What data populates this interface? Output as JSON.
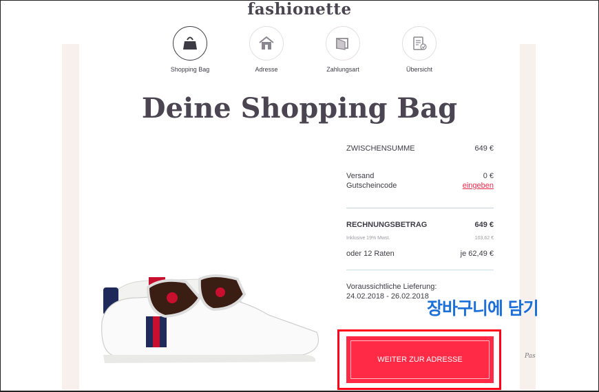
{
  "brand": {
    "logo": "fashionette"
  },
  "steps": [
    {
      "label": "Shopping Bag",
      "icon": "bag-icon",
      "active": true
    },
    {
      "label": "Adresse",
      "icon": "house-icon",
      "active": false
    },
    {
      "label": "Zahlungsart",
      "icon": "wallet-icon",
      "active": false
    },
    {
      "label": "Übersicht",
      "icon": "checklist-icon",
      "active": false
    }
  ],
  "page_title": "Deine Shopping Bag",
  "summary": {
    "subtotal_label": "ZWISCHENSUMME",
    "subtotal_value": "649 €",
    "shipping_label": "Versand",
    "shipping_value": "0 €",
    "voucher_label": "Gutscheincode",
    "voucher_link": "eingeben",
    "total_label": "RECHNUNGSBETRAG",
    "total_value": "649 €",
    "vat_label": "Inklusive 19% Mwst.",
    "vat_value": "103,62 €",
    "installments_label": "oder 12 Raten",
    "installments_value": "je 62,49 €",
    "delivery_label": "Voraussichtliche Lieferung:",
    "delivery_dates": "24.02.2018 - 26.02.2018"
  },
  "cta": {
    "label": "WEITER ZUR ADRESSE"
  },
  "annotation": "장바구니에 담기",
  "side_text": "Pas",
  "colors": {
    "accent": "#ff2a45",
    "highlight_box": "#ff0018",
    "annotation": "#1b6fd6",
    "side_panel": "#f8f0ed"
  }
}
